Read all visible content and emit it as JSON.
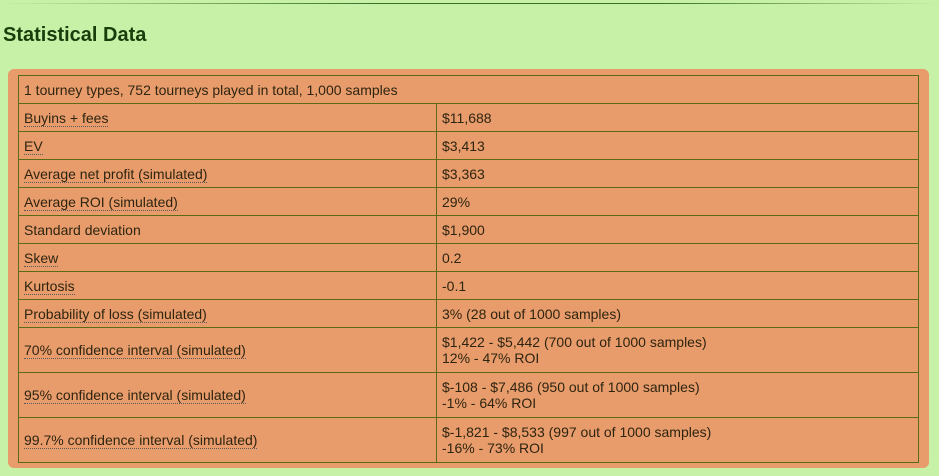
{
  "page": {
    "title": "Statistical Data"
  },
  "summary": "1 tourney types, 752 tourneys played in total, 1,000 samples",
  "rows": [
    {
      "label": "Buyins + fees",
      "value": "$11,688"
    },
    {
      "label": "EV",
      "value": "$3,413"
    },
    {
      "label": "Average net profit (simulated)",
      "value": "$3,363"
    },
    {
      "label": "Average ROI (simulated)",
      "value": "29%"
    },
    {
      "label": "Standard deviation",
      "value": "$1,900"
    },
    {
      "label": "Skew",
      "value": "0.2"
    },
    {
      "label": "Kurtosis",
      "value": "-0.1"
    },
    {
      "label": "Probability of loss (simulated)",
      "value": "3% (28 out of 1000 samples)"
    },
    {
      "label": "70% confidence interval (simulated)",
      "value": "$1,422 - $5,442 (700 out of 1000 samples)",
      "value2": "12% - 47% ROI"
    },
    {
      "label": "95% confidence interval (simulated)",
      "value": "$-108 - $7,486 (950 out of 1000 samples)",
      "value2": "-1% - 64% ROI"
    },
    {
      "label": "99.7% confidence interval (simulated)",
      "value": "$-1,821 - $8,533 (997 out of 1000 samples)",
      "value2": "-16% - 73% ROI"
    }
  ]
}
